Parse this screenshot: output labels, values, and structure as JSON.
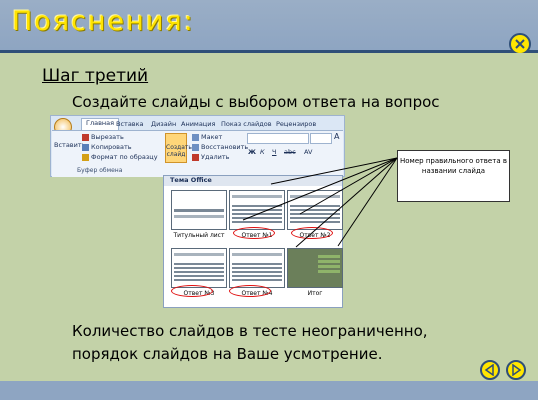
{
  "slide": {
    "title": "Пояснения:",
    "step": "Шаг третий",
    "description": "Создайте слайды с выбором ответа на вопрос",
    "footer": "Количество слайдов в тесте неограниченно, порядок слайдов на Ваше усмотрение."
  },
  "ribbon": {
    "tabs": [
      "Главная",
      "Вставка",
      "Дизайн",
      "Анимация",
      "Показ слайдов",
      "Рецензиров"
    ],
    "cut": "Вырезать",
    "copy": "Копировать",
    "paste": "Вставить",
    "format_painter": "Формат по образцу",
    "clipboard_group": "Буфер обмена",
    "new_slide": "Создать слайд",
    "layout": "Макет",
    "reset": "Восстановить",
    "delete": "Удалить",
    "font_bold": "Ж",
    "font_italic": "К",
    "font_underline": "Ч",
    "font_strike": "abc",
    "font_spacing": "AV",
    "font_size_big": "A"
  },
  "dropdown": {
    "header": "Тема Office",
    "thumbs": [
      {
        "label": "Титульный лист"
      },
      {
        "label": "Ответ №1"
      },
      {
        "label": "Ответ №2"
      },
      {
        "label": "Ответ №3"
      },
      {
        "label": "Ответ №4"
      },
      {
        "label": "Итог"
      }
    ]
  },
  "callout": {
    "text": "Номер правильного ответа в названии слайда"
  },
  "colors": {
    "header": "#8ea5c2",
    "background": "#c3d2a8",
    "title": "#ffe400",
    "accent": "#e01010"
  }
}
